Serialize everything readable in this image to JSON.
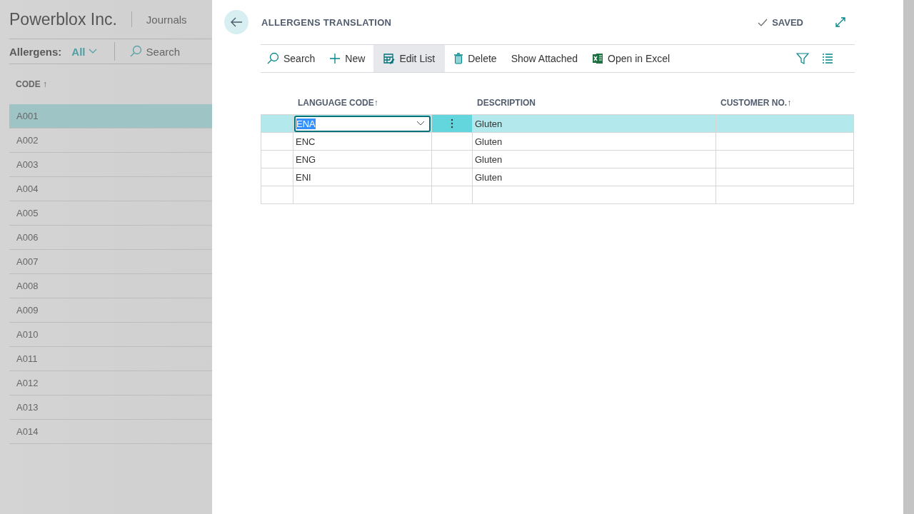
{
  "background": {
    "company": "Powerblox Inc.",
    "nav_item": "Journals",
    "filter_label": "Allergens:",
    "filter_value": "All",
    "search_label": "Search",
    "column": "CODE",
    "column_sort": "↑",
    "rows": [
      {
        "code": "A001",
        "selected": true
      },
      {
        "code": "A002",
        "selected": false
      },
      {
        "code": "A003",
        "selected": false
      },
      {
        "code": "A004",
        "selected": false
      },
      {
        "code": "A005",
        "selected": false
      },
      {
        "code": "A006",
        "selected": false
      },
      {
        "code": "A007",
        "selected": false
      },
      {
        "code": "A008",
        "selected": false
      },
      {
        "code": "A009",
        "selected": false
      },
      {
        "code": "A010",
        "selected": false
      },
      {
        "code": "A011",
        "selected": false
      },
      {
        "code": "A012",
        "selected": false
      },
      {
        "code": "A013",
        "selected": false
      },
      {
        "code": "A014",
        "selected": false
      }
    ]
  },
  "dialog": {
    "title": "ALLERGENS TRANSLATION",
    "status": "SAVED",
    "actions": [
      {
        "label": "Search",
        "kind": "search",
        "selected": false
      },
      {
        "label": "New",
        "kind": "new",
        "selected": false
      },
      {
        "label": "Edit List",
        "kind": "edit",
        "selected": true
      },
      {
        "label": "Delete",
        "kind": "delete",
        "selected": false
      },
      {
        "label": "Show Attached",
        "kind": "text",
        "selected": false
      },
      {
        "label": "Open in Excel",
        "kind": "spreadsheet",
        "selected": false
      }
    ],
    "columns": [
      {
        "label": "LANGUAGE CODE",
        "sort": "↑"
      },
      {
        "label": "DESCRIPTION"
      },
      {
        "label": "CUSTOMER NO.",
        "sort": "↑"
      }
    ],
    "rows": [
      {
        "language_code": "ENA",
        "description": "Gluten",
        "selected": true
      },
      {
        "language_code": "ENC",
        "description": "Gluten",
        "selected": false
      },
      {
        "language_code": "ENG",
        "description": "Gluten",
        "selected": false
      },
      {
        "language_code": "ENI",
        "description": "Gluten",
        "selected": false
      }
    ]
  }
}
